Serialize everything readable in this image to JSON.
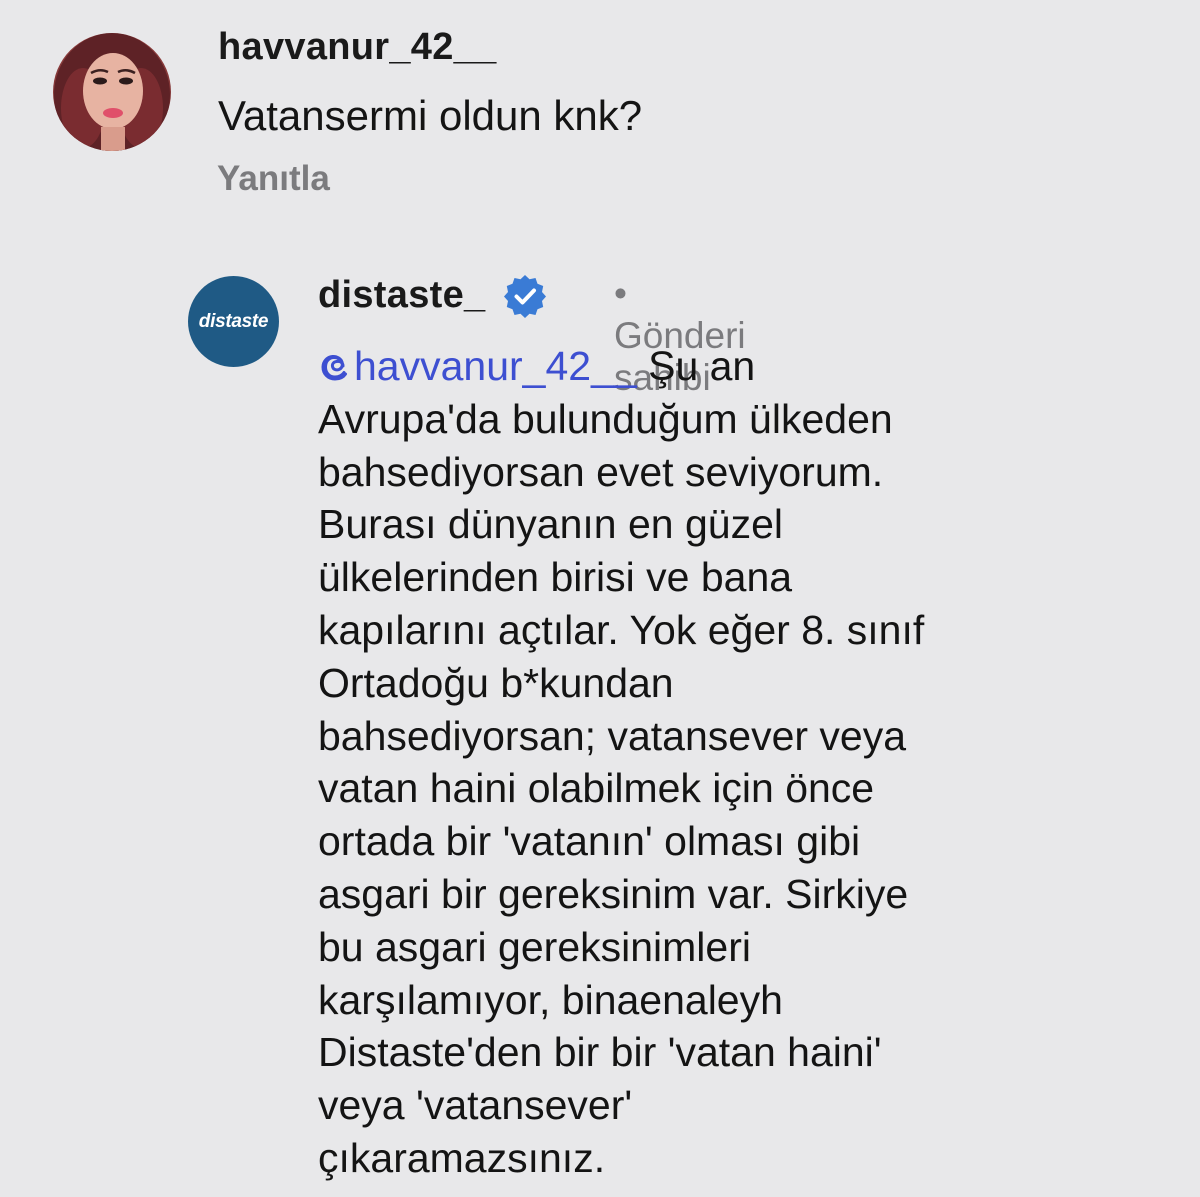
{
  "comments": [
    {
      "username": "havvanur_42__",
      "text": "Vatansermi oldun knk?",
      "reply_label": "Yanıtla"
    },
    {
      "username": "distaste_",
      "avatar_text": "distaste",
      "verified": true,
      "owner_label": "• Gönderi sahibi",
      "mention": "havvanur_42__",
      "lines": [
        "Şu an",
        "Avrupa'da bulunduğum ülkeden",
        "bahsediyorsan evet seviyorum.",
        "Burası dünyanın en güzel",
        "ülkelerinden birisi ve bana",
        "kapılarını açtılar. Yok eğer 8. sınıf",
        "Ortadoğu b*kundan",
        "bahsediyorsan; vatansever veya",
        "vatan haini olabilmek için önce",
        "ortada bir 'vatanın' olması gibi",
        "asgari bir gereksinim var. Sirkiye",
        "bu asgari gereksinimleri",
        "karşılamıyor, binaenaleyh",
        "Distaste'den bir bir 'vatan haini'",
        "veya 'vatansever'",
        "çıkaramazsınız."
      ]
    }
  ],
  "colors": {
    "background": "#e8e8ea",
    "mention": "#3d4fd1",
    "muted": "#7b7b7e",
    "verified": "#3a7bd5",
    "brand_avatar": "#1f5a85"
  }
}
